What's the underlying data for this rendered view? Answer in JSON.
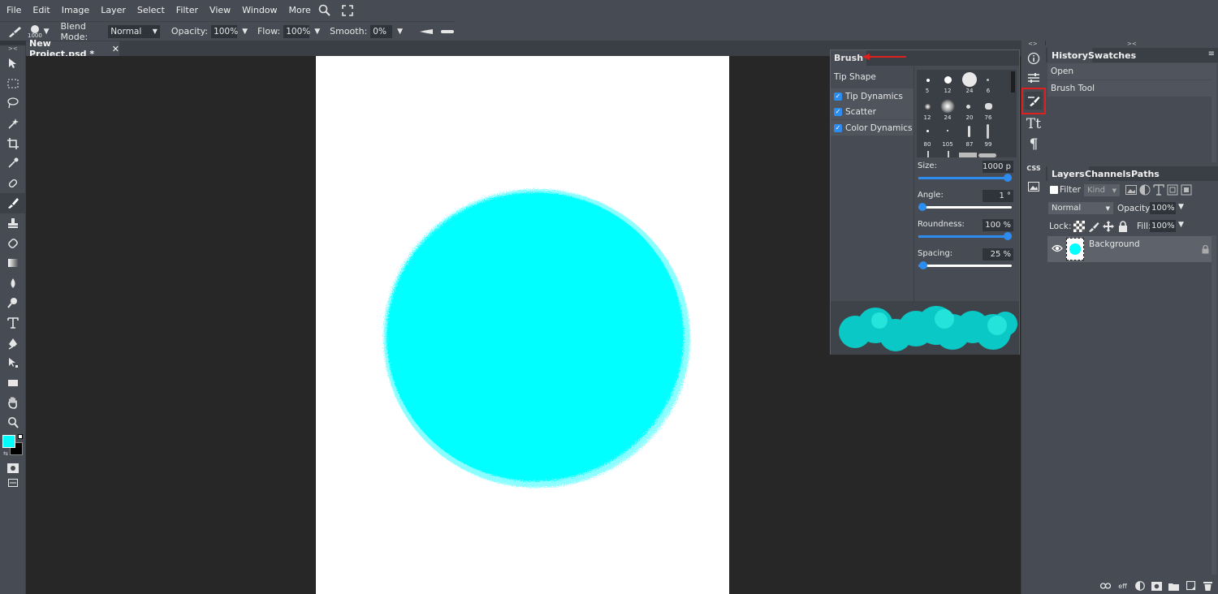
{
  "menu": {
    "items": [
      "File",
      "Edit",
      "Image",
      "Layer",
      "Select",
      "Filter",
      "View",
      "Window",
      "More"
    ],
    "search_icon": "search-icon",
    "fullscreen_icon": "fullscreen-icon"
  },
  "options": {
    "brush_size_label": "1000",
    "blend_mode_label": "Blend Mode:",
    "blend_mode_value": "Normal",
    "opacity_label": "Opacity:",
    "opacity_value": "100%",
    "flow_label": "Flow:",
    "flow_value": "100%",
    "smooth_label": "Smooth:",
    "smooth_value": "0%"
  },
  "document": {
    "tab_title": "New Project.psd *",
    "close": "✕"
  },
  "brush_panel": {
    "tab": "Brush",
    "tip_shape": "Tip Shape",
    "options": [
      {
        "label": "Tip Dynamics",
        "checked": true
      },
      {
        "label": "Scatter",
        "checked": true
      },
      {
        "label": "Color Dynamics",
        "checked": true
      }
    ],
    "presets": [
      "5",
      "12",
      "24",
      "6",
      "12",
      "24",
      "20",
      "76",
      "80",
      "105",
      "87",
      "99"
    ],
    "sliders": [
      {
        "label": "Size:",
        "value": "1000 p",
        "level": 1.0
      },
      {
        "label": "Angle:",
        "value": "1 °",
        "level": 0.0
      },
      {
        "label": "Roundness:",
        "value": "100 %",
        "level": 1.0
      },
      {
        "label": "Spacing:",
        "value": "25 %",
        "level": 0.05
      }
    ]
  },
  "history_panel": {
    "tabs": [
      "History",
      "Swatches"
    ],
    "items": [
      "Open",
      "Brush Tool"
    ]
  },
  "layers_panel": {
    "tabs": [
      "Layers",
      "Channels",
      "Paths"
    ],
    "filter_label": "Filter",
    "kind_value": "Kind",
    "blend_value": "Normal",
    "opacity_label": "Opacity:",
    "opacity_value": "100%",
    "lock_label": "Lock:",
    "fill_label": "Fill:",
    "fill_value": "100%",
    "layer_name": "Background",
    "bottom_eff": "eff"
  },
  "iconstrip": {
    "css_label": "CSS",
    "pilcrow": "¶",
    "text_glyph": "Tt"
  },
  "colors": {
    "foreground": "#00ffff",
    "background": "#000000",
    "brush_paint": "#00ffff",
    "accent": "#2d8cf0",
    "highlight": "#e0201e"
  }
}
